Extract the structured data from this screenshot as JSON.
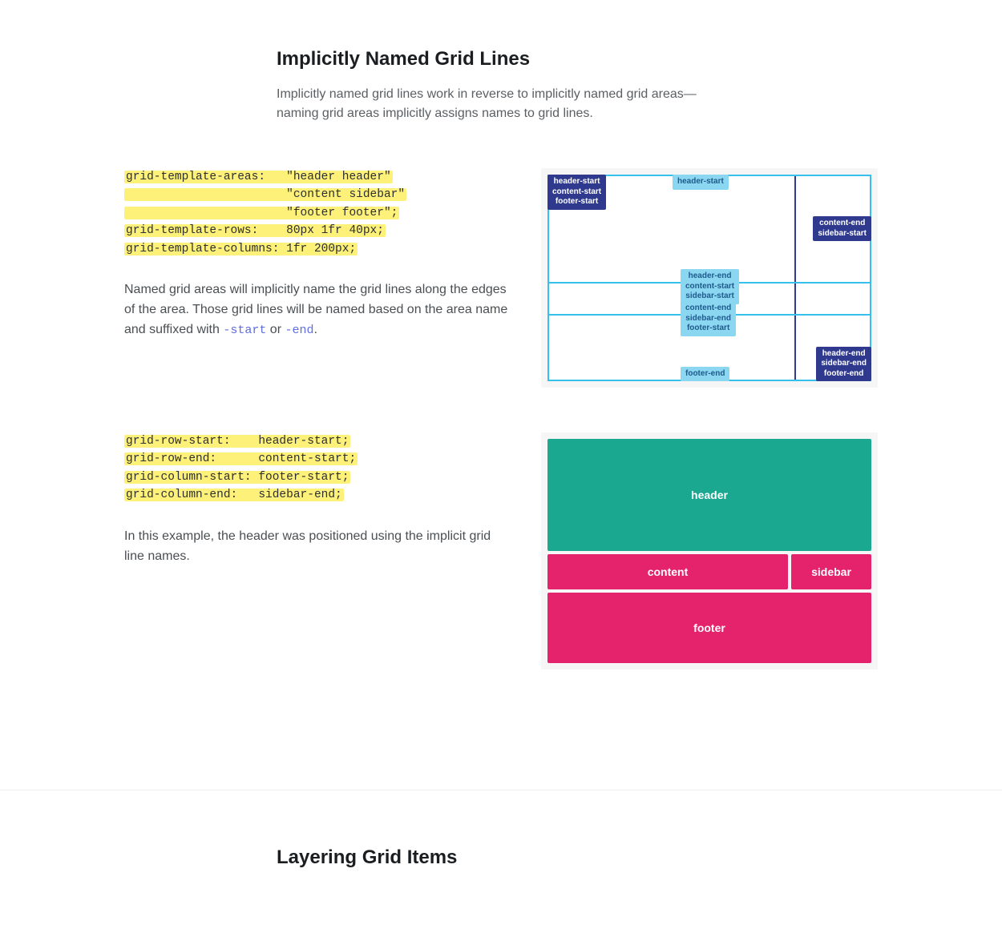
{
  "section1": {
    "title": "Implicitly Named Grid Lines",
    "lead": "Implicitly named grid lines work in reverse to implicitly named grid areas—naming grid areas implicitly assigns names to grid lines."
  },
  "code1": {
    "line1a": "grid-template-areas:   \"header header\"",
    "line1b": "                       \"content sidebar\"",
    "line1c": "                       \"footer footer\";",
    "line2": "grid-template-rows:    80px 1fr 40px;",
    "line3": "grid-template-columns: 1fr 200px;"
  },
  "explain1": {
    "pre": "Named grid areas will implicitly name the grid lines along the edges of the area. Those grid lines will be named based on the area name and suffixed with ",
    "code_start": "-start",
    "mid": " or ",
    "code_end": "-end",
    "post": "."
  },
  "diag1": {
    "topLeft": "header-start\ncontent-start\nfooter-start",
    "topMid": "header-start",
    "rightUpper": "content-end\nsidebar-start",
    "mid1": "header-end\ncontent-start\nsidebar-start",
    "mid2": "content-end\nsidebar-end\nfooter-start",
    "bottomRight": "header-end\nsidebar-end\nfooter-end",
    "bottomMid": "footer-end"
  },
  "code2": {
    "l1": "grid-row-start:    header-start;",
    "l2": "grid-row-end:      content-start;",
    "l3": "grid-column-start: footer-start;",
    "l4": "grid-column-end:   sidebar-end;"
  },
  "explain2": "In this example, the header was positioned using the implicit grid line names.",
  "diag2": {
    "header": "header",
    "content": "content",
    "sidebar": "sidebar",
    "footer": "footer"
  },
  "section2": {
    "title": "Layering Grid Items"
  }
}
